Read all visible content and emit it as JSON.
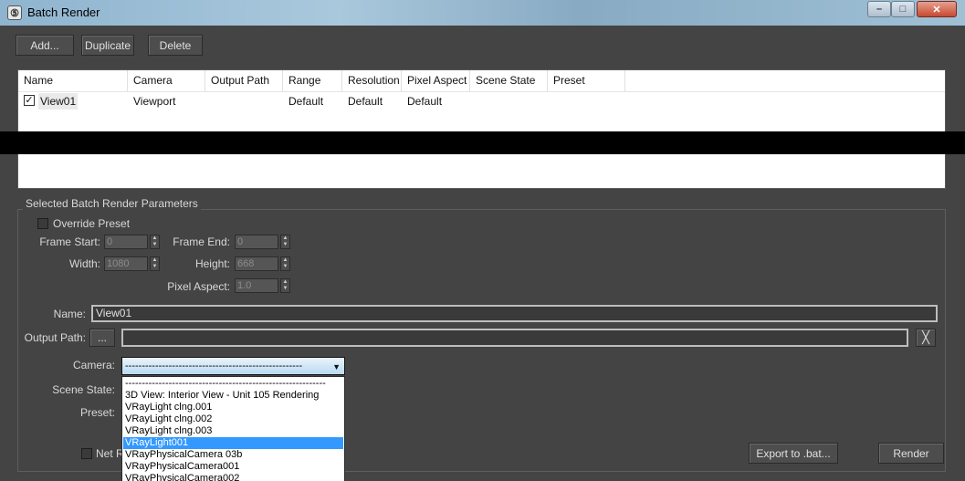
{
  "window": {
    "title": "Batch Render",
    "app_icon": "3ds-max-icon",
    "minimize_label": "–",
    "maximize_label": "□",
    "close_label": "✕"
  },
  "toolbar": {
    "add_label": "Add...",
    "duplicate_label": "Duplicate",
    "delete_label": "Delete"
  },
  "table": {
    "columns": [
      "Name",
      "Camera",
      "Output Path",
      "Range",
      "Resolution",
      "Pixel Aspect",
      "Scene State",
      "Preset"
    ],
    "rows": [
      {
        "checked": true,
        "name": "View01",
        "camera": "Viewport",
        "output_path": "",
        "range": "Default",
        "resolution": "Default",
        "pixel_aspect": "Default",
        "scene_state": "",
        "preset": ""
      }
    ]
  },
  "params": {
    "group_title": "Selected Batch Render Parameters",
    "override_preset_label": "Override Preset",
    "override_preset_checked": false,
    "frame_start_label": "Frame Start:",
    "frame_start_value": "0",
    "frame_end_label": "Frame End:",
    "frame_end_value": "0",
    "width_label": "Width:",
    "width_value": "1080",
    "height_label": "Height:",
    "height_value": "668",
    "pixel_aspect_label": "Pixel Aspect:",
    "pixel_aspect_value": "1.0",
    "name_label": "Name:",
    "name_value": "View01",
    "output_path_label": "Output Path:",
    "browse_label": "...",
    "output_path_value": "",
    "clear_icon": "clear-x-icon",
    "camera_label": "Camera:",
    "camera_value": "-----------------------------------------------------",
    "scene_state_label": "Scene State:",
    "preset_label": "Preset:"
  },
  "camera_dropdown": {
    "selected_index": 4,
    "options": [
      "------------------------------------------------------------",
      "3D View: Interior View - Unit 105 Rendering",
      "VRayLight clng.001",
      "VRayLight clng.002",
      "VRayLight clng.003",
      "VRayLight001",
      "VRayPhysicalCamera 03b",
      "VRayPhysicalCamera001",
      "VRayPhysicalCamera002"
    ]
  },
  "footer": {
    "net_render_label": "Net R",
    "net_render_checked": false,
    "export_label": "Export to .bat...",
    "render_label": "Render"
  },
  "colors": {
    "background": "#444444",
    "selection": "#3399ff",
    "titlebar": "#9fc0d5"
  }
}
